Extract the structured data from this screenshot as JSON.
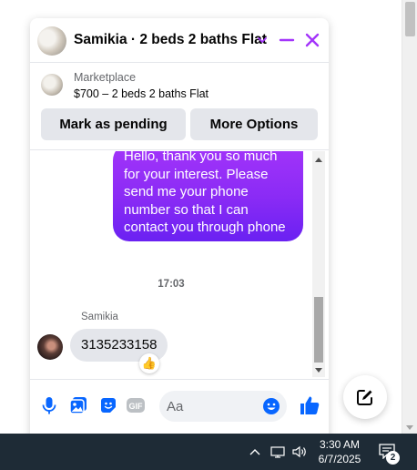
{
  "colors": {
    "accent": "#a334fa",
    "messenger_blue": "#0866ff",
    "bubble_gray": "#e4e6eb",
    "taskbar": "#1e2b36"
  },
  "chat": {
    "title": "Samikia · 2 beds 2 baths Flat",
    "icons": [
      "chevron-down-icon",
      "minimize-icon",
      "close-icon"
    ],
    "marketplace": {
      "label": "Marketplace",
      "listing": "$700 – 2 beds 2 baths Flat",
      "mark_pending": "Mark as pending",
      "more_options": "More Options"
    },
    "messages": {
      "outgoing": "Hello, thank you so much\nfor your interest. Please\nsend me your phone\nnumber so that I can\ncontact you through phone",
      "timestamp": "17:03",
      "sender": "Samikia",
      "incoming": "3135233158",
      "reaction": "👍"
    },
    "composer": {
      "placeholder": "Aa",
      "icons": [
        "microphone-icon",
        "photo-icon",
        "sticker-icon",
        "gif-icon",
        "emoji-icon",
        "like-icon"
      ],
      "gif_label": "GIF"
    }
  },
  "taskbar": {
    "time": "3:30 AM",
    "date": "6/7/2025",
    "notification_count": "2"
  }
}
